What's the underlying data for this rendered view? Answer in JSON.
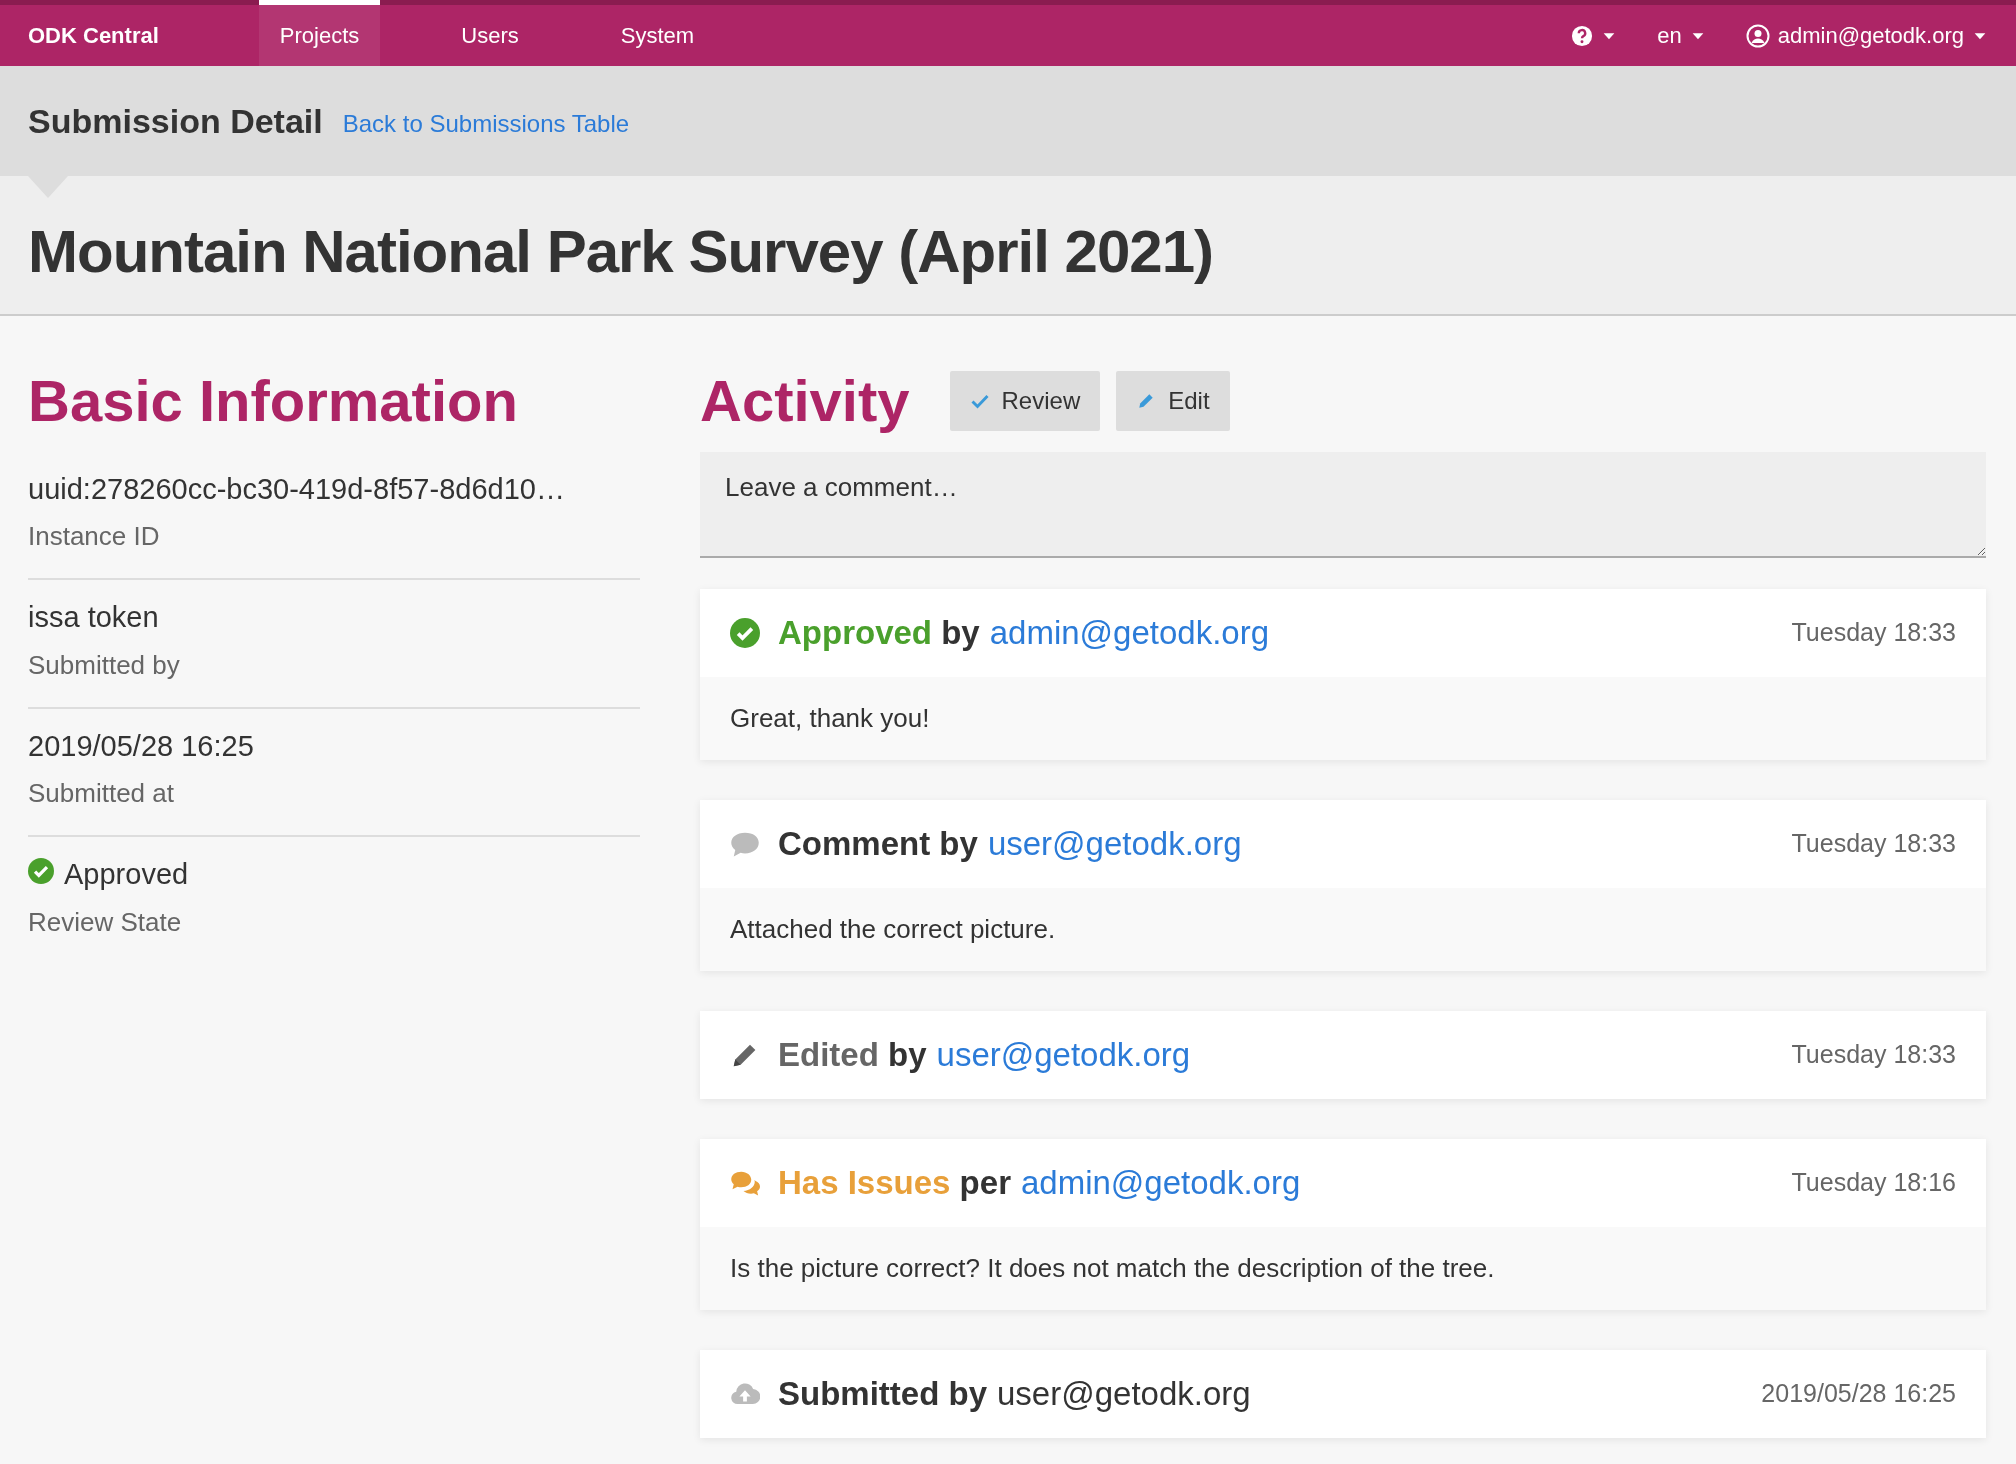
{
  "navbar": {
    "brand": "ODK Central",
    "items": [
      {
        "label": "Projects",
        "selected": true
      },
      {
        "label": "Users",
        "selected": false
      },
      {
        "label": "System",
        "selected": false
      }
    ],
    "language": "en",
    "user": "admin@getodk.org"
  },
  "page_header": {
    "title": "Submission Detail",
    "back_link": "Back to Submissions Table",
    "form_title": "Mountain National Park Survey (April 2021)"
  },
  "basic_info": {
    "heading": "Basic Information",
    "fields": [
      {
        "kind": "text",
        "value": "uuid:278260cc-bc30-419d-8f57-8d6d10…",
        "label": "Instance ID"
      },
      {
        "kind": "text",
        "value": "issa token",
        "label": "Submitted by"
      },
      {
        "kind": "text",
        "value": "2019/05/28 16:25",
        "label": "Submitted at"
      },
      {
        "kind": "approved",
        "value": "Approved",
        "label": "Review State"
      }
    ]
  },
  "activity": {
    "heading": "Activity",
    "buttons": [
      {
        "kind": "review",
        "label": "Review"
      },
      {
        "kind": "edit",
        "label": "Edit"
      }
    ],
    "comment": {
      "placeholder": "Leave a comment…"
    },
    "feed": [
      {
        "kind": "approved",
        "status": "Approved",
        "connector": "by",
        "actor": "admin@getodk.org",
        "actor_link": true,
        "time": "Tuesday 18:33",
        "body": "Great, thank you!"
      },
      {
        "kind": "comment",
        "status": "Comment",
        "connector": "by",
        "actor": "user@getodk.org",
        "actor_link": true,
        "time": "Tuesday 18:33",
        "body": "Attached the correct picture."
      },
      {
        "kind": "edited",
        "status": "Edited",
        "connector": "by",
        "actor": "user@getodk.org",
        "actor_link": true,
        "time": "Tuesday 18:33"
      },
      {
        "kind": "has_issues",
        "status": "Has Issues",
        "connector": "per",
        "actor": "admin@getodk.org",
        "actor_link": true,
        "time": "Tuesday 18:16",
        "body": "Is the picture correct? It does not match the description of the tree."
      },
      {
        "kind": "submitted",
        "status": "Submitted",
        "connector": "by",
        "actor": "user@getodk.org",
        "actor_link": false,
        "time": "2019/05/28 16:25"
      }
    ]
  }
}
